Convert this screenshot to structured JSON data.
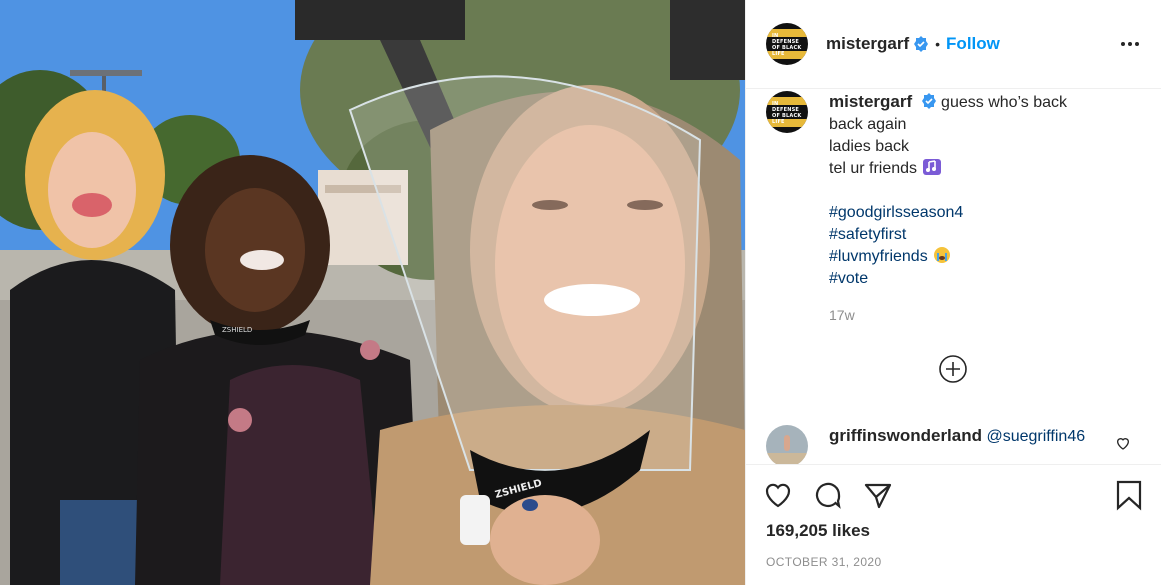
{
  "post": {
    "username": "mistergarf",
    "verified": true,
    "follow_label": "Follow",
    "more_icon": "more-horizontal-icon",
    "avatar_text": "IN DEFENSE OF BLACK LIFE"
  },
  "caption": {
    "username": "mistergarf",
    "lines": [
      "guess who’s back",
      "back again",
      "ladies back",
      "tel ur friends"
    ],
    "hashtags": [
      "#goodgirlsseason4",
      "#safetyfirst",
      "#luvmyfriends",
      "#vote"
    ],
    "age": "17w"
  },
  "comments": [
    {
      "username": "griffinswonderland",
      "mention": "@suegriffin46"
    }
  ],
  "actions": {
    "like_icon": "heart-icon",
    "comment_icon": "comment-icon",
    "share_icon": "share-icon",
    "save_icon": "bookmark-icon"
  },
  "likes_text": "169,205 likes",
  "date_text": "OCTOBER 31, 2020",
  "photo": {
    "shield_text_1": "ZSHIELD",
    "shield_text_2": "ZSHIELD"
  },
  "colors": {
    "accent": "#0095f6",
    "hashtag": "#00376b",
    "muted": "#8e8e8e",
    "border": "#efefef"
  }
}
